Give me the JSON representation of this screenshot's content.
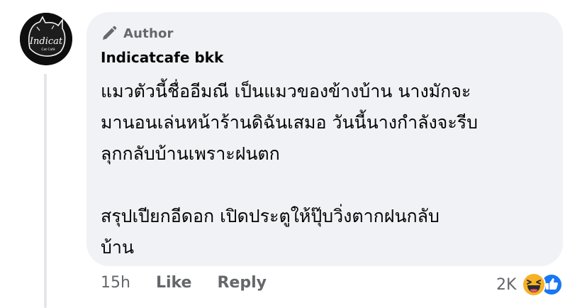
{
  "avatar": {
    "text": "Indicat",
    "subtext": "Cat Café"
  },
  "comment": {
    "author_badge": "Author",
    "author_name": "Indicatcafe bkk",
    "text": "แมวตัวนี้ชื่ออีมณี เป็นแมวของข้างบ้าน นางมักจะ\nมานอนเล่นหน้าร้านดิฉันเสมอ วันนี้นางกำลังจะรีบ\nลุกกลับบ้านเพราะฝนตก\n\nสรุปเปียกอีดอก เปิดประตูให้ปุ๊บวิ่งตากฝนกลับ\nบ้าน"
  },
  "actions": {
    "time": "15h",
    "like": "Like",
    "reply": "Reply"
  },
  "reactions": {
    "count": "2K",
    "icons": [
      "haha-icon",
      "like-reaction-icon"
    ]
  },
  "colors": {
    "bubble": "#f0f2f5",
    "meta_text": "#65676b",
    "like_blue": "#1877f2",
    "haha_yellow": "#f7b125"
  }
}
